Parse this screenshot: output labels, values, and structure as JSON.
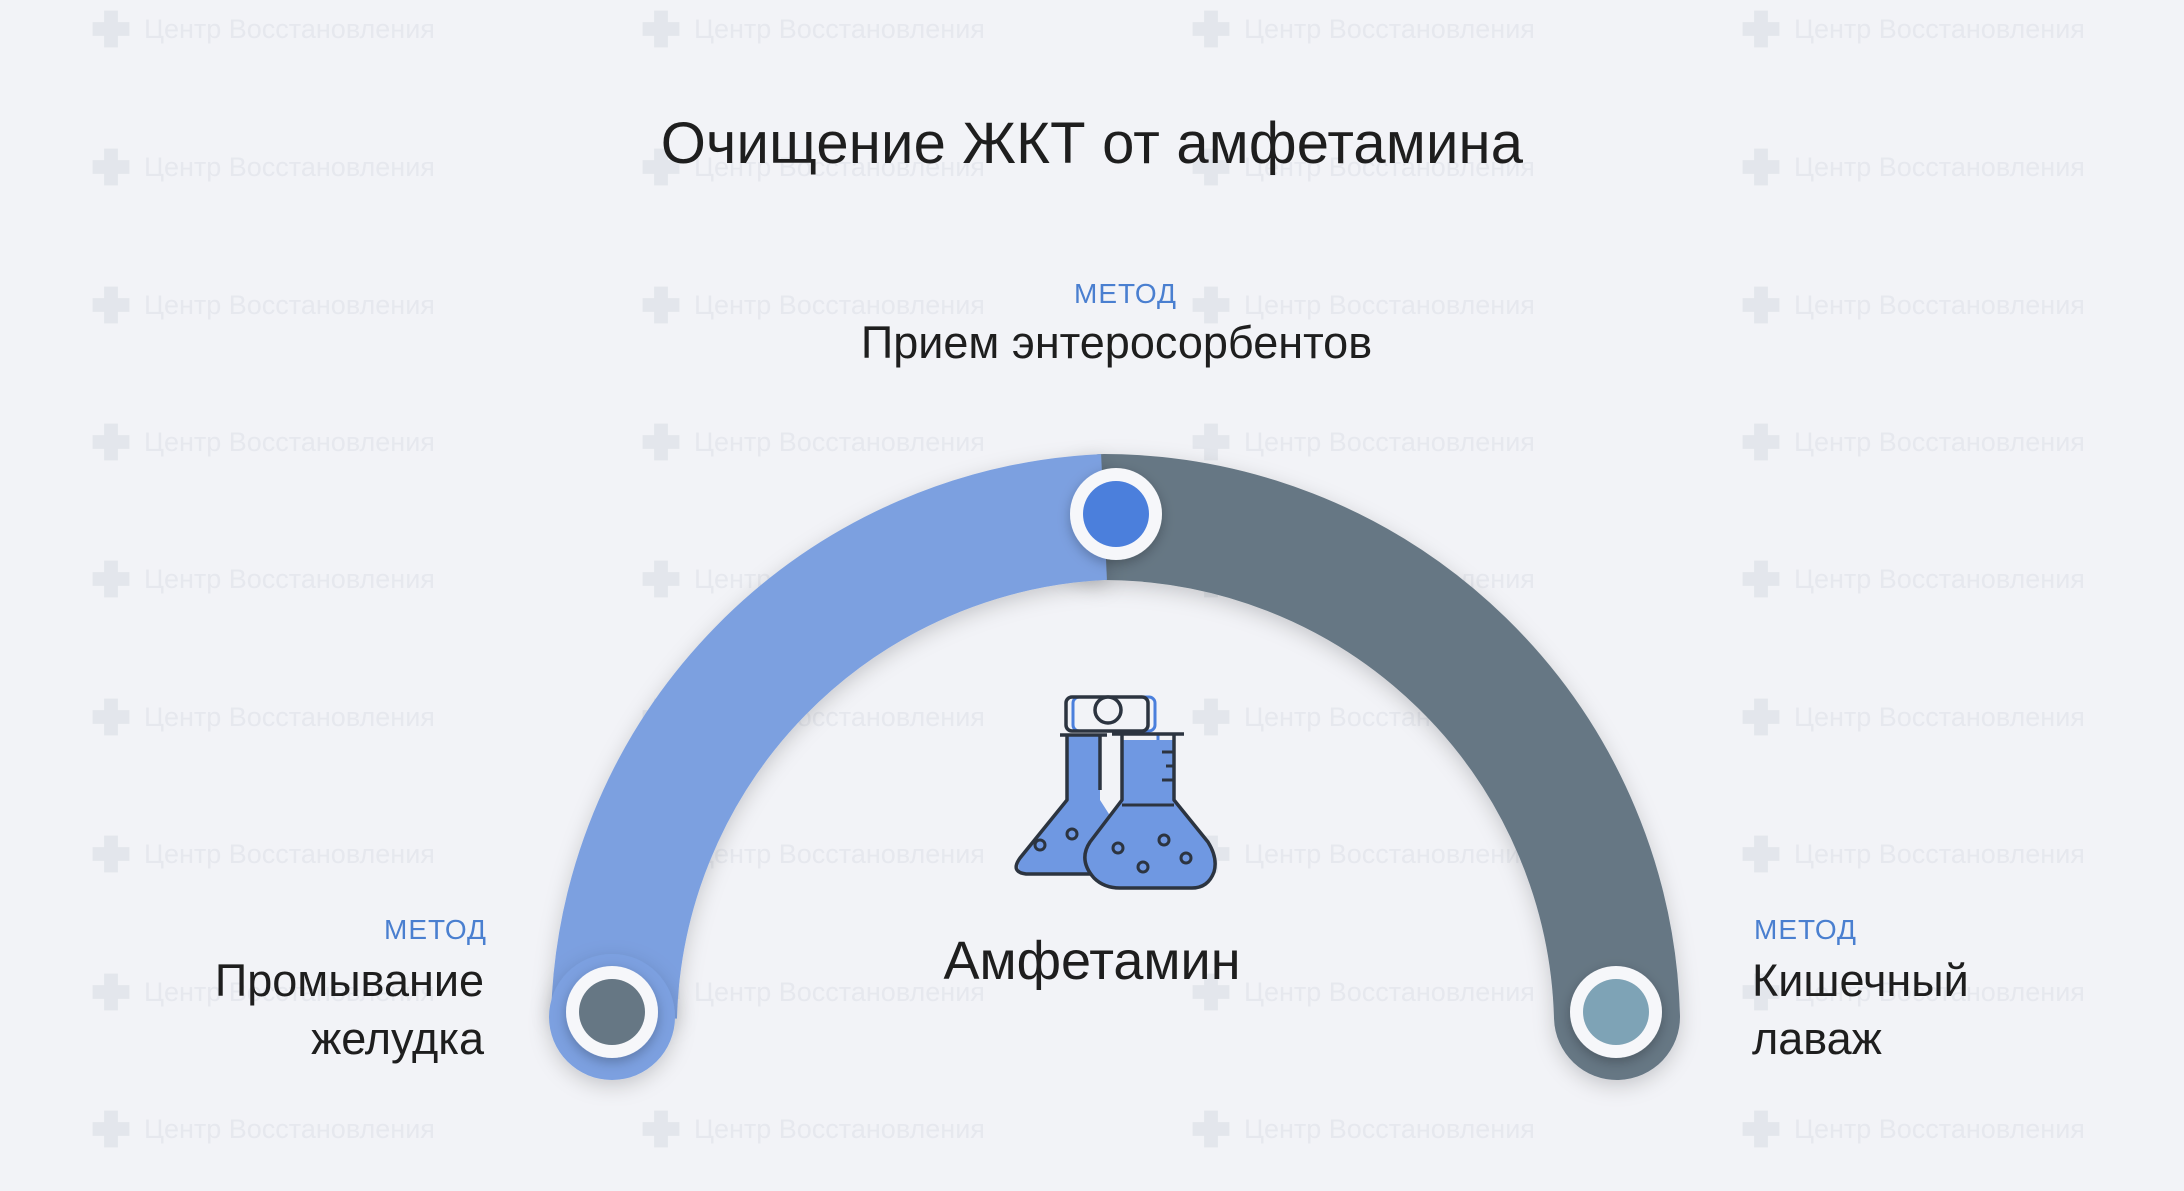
{
  "title": "Очищение ЖКТ от амфетамина",
  "watermark": {
    "text": "Центр Восстановления",
    "icon": "cross-logo-icon"
  },
  "methods": [
    {
      "tag": "МЕТОД",
      "name": "Промывание\nжелудка",
      "position": "left",
      "dot_color": "#667784"
    },
    {
      "tag": "МЕТОД",
      "name": "Прием энтеросорбентов",
      "position": "top",
      "dot_color": "#4b7fdc"
    },
    {
      "tag": "МЕТОД",
      "name": "Кишечный\nлаваж",
      "position": "right",
      "dot_color": "#7ea3b6"
    }
  ],
  "center": {
    "label": "Амфетамин",
    "icon": "chemistry-flasks-icon"
  },
  "colors": {
    "arc_left": "#7ca0e0",
    "arc_right": "#667784",
    "accent": "#4a7fd0",
    "background": "#f2f3f7"
  }
}
